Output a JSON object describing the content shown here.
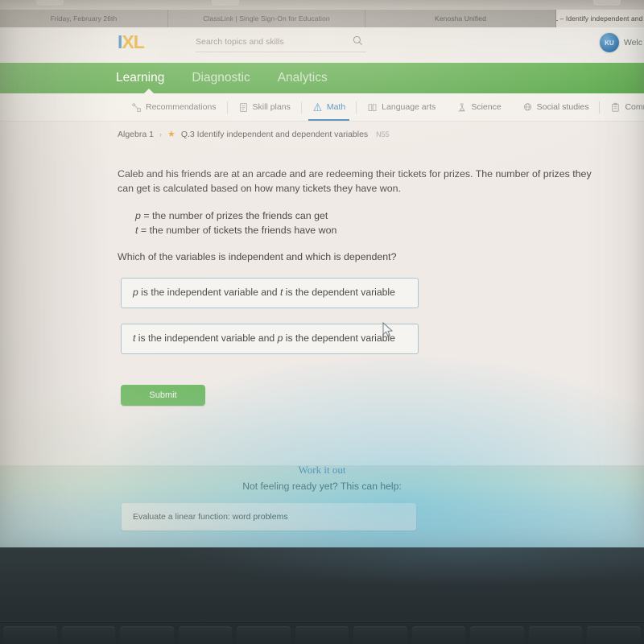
{
  "browser": {
    "tabs": [
      {
        "title": "Friday, February 26th",
        "active": false
      },
      {
        "title": "ClassLink | Single Sign-On for Education",
        "active": false
      },
      {
        "title": "Kenosha Unified",
        "active": false
      },
      {
        "title": "IXL – Identify independent and de",
        "active": true
      }
    ]
  },
  "header": {
    "logo_i": "I",
    "logo_xl": "XL",
    "search_placeholder": "Search topics and skills",
    "welcome_text": "Welc",
    "avatar_initials": "KU"
  },
  "primary_nav": {
    "items": [
      {
        "label": "Learning",
        "active": true
      },
      {
        "label": "Diagnostic",
        "active": false
      },
      {
        "label": "Analytics",
        "active": false
      }
    ]
  },
  "subject_nav": {
    "items": [
      {
        "label": "Recommendations",
        "icon": "recommendations-icon",
        "active": false
      },
      {
        "label": "Skill plans",
        "icon": "skill-plans-icon",
        "active": false
      },
      {
        "label": "Math",
        "icon": "math-icon",
        "active": true
      },
      {
        "label": "Language arts",
        "icon": "book-icon",
        "active": false
      },
      {
        "label": "Science",
        "icon": "microscope-icon",
        "active": false
      },
      {
        "label": "Social studies",
        "icon": "globe-icon",
        "active": false
      },
      {
        "label": "Common",
        "icon": "clipboard-icon",
        "active": false
      }
    ]
  },
  "breadcrumb": {
    "course": "Algebra 1",
    "separator": "›",
    "star": "★",
    "skill": "Q.3 Identify independent and dependent variables",
    "code": "N55"
  },
  "question": {
    "body": "Caleb and his friends are at an arcade and are redeeming their tickets for prizes. The number of prizes they can get is calculated based on how many tickets they have won.",
    "var_p_symbol": "p",
    "var_p_def": " = the number of prizes the friends can get",
    "var_t_symbol": "t",
    "var_t_def": " = the number of tickets the friends have won",
    "prompt": "Which of the variables is independent and which is dependent?",
    "choices": [
      {
        "sym1": "p",
        "mid": " is the independent variable and ",
        "sym2": "t",
        "tail": " is the dependent variable"
      },
      {
        "sym1": "t",
        "mid": " is the independent variable and ",
        "sym2": "p",
        "tail": " is the dependent variable"
      }
    ],
    "submit_label": "Submit"
  },
  "work_it_out": {
    "title": "Work it out",
    "subtitle": "Not feeling ready yet? This can help:",
    "help_link": "Evaluate a linear function: word problems"
  },
  "colors": {
    "ixl_green": "#5aa84c",
    "ixl_blue": "#3f86b5",
    "logo_blue": "#4a90c4",
    "logo_gold": "#e8b13a",
    "submit_green": "#76bb6a",
    "choice_border": "#a9c4cc"
  }
}
